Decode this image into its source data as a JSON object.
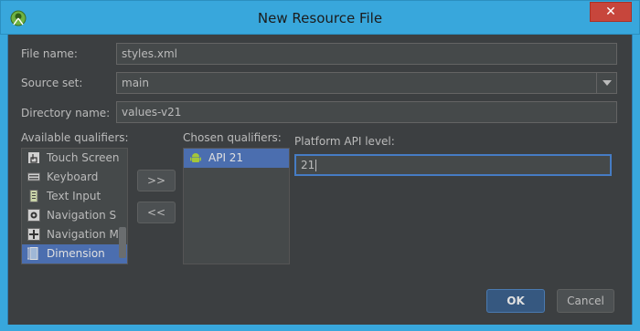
{
  "window": {
    "title": "New Resource File",
    "close_label": "✕"
  },
  "form": {
    "file_name_label": "File name:",
    "file_name_value": "styles.xml",
    "source_set_label": "Source set:",
    "source_set_value": "main",
    "directory_label": "Directory name:",
    "directory_value": "values-v21"
  },
  "qualifiers": {
    "available_label": "Available qualifiers:",
    "available_items": [
      {
        "label": "Touch Screen",
        "icon": "touch-icon"
      },
      {
        "label": "Keyboard",
        "icon": "keyboard-icon"
      },
      {
        "label": "Text Input",
        "icon": "text-input-icon"
      },
      {
        "label": "Navigation S",
        "icon": "navigation-state-icon"
      },
      {
        "label": "Navigation M",
        "icon": "navigation-method-icon"
      },
      {
        "label": "Dimension",
        "icon": "dimension-icon"
      }
    ],
    "add_label": ">>",
    "remove_label": "<<",
    "chosen_label": "Chosen qualifiers:",
    "chosen_items": [
      {
        "label": "API 21",
        "icon": "android-icon"
      }
    ]
  },
  "platform": {
    "label": "Platform API level:",
    "value": "21"
  },
  "buttons": {
    "ok_label": "OK",
    "cancel_label": "Cancel"
  },
  "colors": {
    "title_bar": "#38a7dc",
    "close_button": "#c7463c",
    "selection": "#4b6eaf",
    "background": "#3c3f41"
  }
}
